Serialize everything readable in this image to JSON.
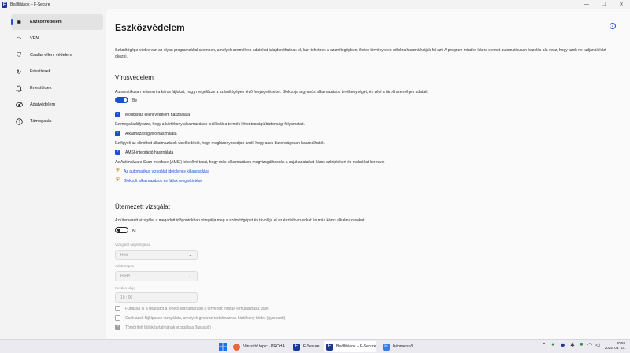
{
  "window": {
    "title": "Beállítások – F-Secure",
    "app_icon": "f-secure-logo",
    "controls": [
      "—",
      "❐",
      "✕"
    ]
  },
  "sidebar": {
    "items": [
      {
        "label": "Eszközvédelem",
        "icon": "device-protection-icon",
        "glyph": "✺",
        "active": true
      },
      {
        "label": "VPN",
        "icon": "wifi-icon",
        "glyph": "◠",
        "active": false
      },
      {
        "label": "Csalás elleni védelem",
        "icon": "shopping-bag-icon",
        "glyph": "⛉",
        "active": false
      },
      {
        "label": "Frissítések",
        "icon": "refresh-icon",
        "glyph": "↻",
        "active": false
      },
      {
        "label": "Értesítések",
        "icon": "bell-icon",
        "glyph": "♫",
        "active": false
      },
      {
        "label": "Adatvédelem",
        "icon": "privacy-eye-icon",
        "glyph": "◎",
        "active": false
      },
      {
        "label": "Támogatás",
        "icon": "help-icon",
        "glyph": "?",
        "active": false
      }
    ]
  },
  "main": {
    "title": "Eszközvédelem",
    "help_glyph": "?",
    "intro": "Számítógépe védve van az olyan programokkal szemben, amelyek személyes adatokat tulajdoníthatnak el, kárt tehetnek a számítógépben, illetve törvénytelen célokra használhatják fel azt. A program minden káros elemet automatikusan kezelés alá vesz, hogy azok ne tudjanak kárt okozni.",
    "virus": {
      "title": "Vírusvédelem",
      "desc": "Automatikusan felismeri a káros fájlokat, hogy megelőzze a számítógépen lévő fenyegetéseket. Blokkolja a gyanús alkalmazások tevékenységét, és védi a tárolt személyes adatait.",
      "toggle_label": "Be",
      "tamper": {
        "label": "Módosítás elleni védelem használata",
        "desc": "Ez megakadályozza, hogy a kártékony alkalmazások leállítsák a termék létfontosságú biztonsági folyamatait."
      },
      "appmon": {
        "label": "Alkalmazásfigyelő használata",
        "desc": "Ez figyeli az elindított alkalmazások viselkedését, hogy megbizonyosodjon arról, hogy azok biztonságosan használhatók."
      },
      "amsi": {
        "label": "AMSI-integráció használata",
        "desc": "Az Antimalware Scan Interface (AMSI) lehetővé teszi, hogy más alkalmazások megvizsgálhassák a saját adataikat káros szkriptekért és makrókat keresve."
      },
      "link1": "Az automatikus vizsgálat ideiglenes kikapcsolása",
      "link2": "Blokkolt alkalmazások és fájlok megtekintése"
    },
    "scheduled": {
      "title": "Ütemezett vizsgálat",
      "desc": "Az ütemezett vizsgálat a megadott időpontokban vizsgálja meg a számítógépet és távolítja el az észlelt vírusokat és más káros alkalmazásokat.",
      "toggle_label": "Ki",
      "freq_label": "Vizsgálat végrehajtása",
      "freq_value": "Heti",
      "day_label": "Adott napon",
      "day_value": "Hétfő",
      "time_label": "Kezdés ideje",
      "time_value": "10 : 00",
      "opt1": "Futtassa le a feladatot a lehető leghamarabb a tervezett indítás elmulasztása után",
      "opt2": "Csak azok fájltípusok vizsgálata, amelyek gyakran tartalmaznak kártékony kódot (gyorsabb)",
      "opt3": "Tömörített fájlok tartalmának vizsgálata (lassabb)"
    }
  },
  "taskbar": {
    "start_icon": "windows-start-icon",
    "tasks": [
      {
        "label": "Vírusirtó topic - PROHA",
        "icon": "firefox-icon"
      },
      {
        "label": "F-Secure",
        "icon": "f-secure-icon"
      },
      {
        "label": "Beállítások – F-Secure",
        "icon": "f-secure-icon"
      },
      {
        "label": "Képmetsző",
        "icon": "snipping-tool-icon"
      }
    ],
    "clock_time": "20:58",
    "clock_date": "2025. 03. 03."
  },
  "colors": {
    "accent": "#1a4fd8",
    "sidebar_bg": "#f3f3f3",
    "content_bg": "#fafafa"
  }
}
